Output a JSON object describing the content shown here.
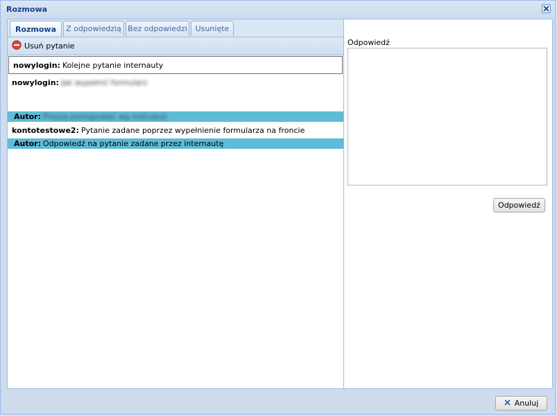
{
  "window": {
    "title": "Rozmowa"
  },
  "tabs": [
    {
      "label": "Rozmowa",
      "active": true
    },
    {
      "label": "Z odpowiedzią",
      "active": false
    },
    {
      "label": "Bez odpowiedzi",
      "active": false
    },
    {
      "label": "Usunięte",
      "active": false
    }
  ],
  "toolbar": {
    "delete_label": "Usuń pytanie"
  },
  "messages": [
    {
      "author": "nowylogin:",
      "text": "Kolejne pytanie internauty",
      "type": "question",
      "selected": true
    },
    {
      "author": "nowylogin:",
      "text": "Jak wypełnić formularz",
      "type": "question",
      "redacted": true
    },
    {
      "author": "Autor:",
      "text": "Proszę postępować wg instrukcji",
      "type": "answer",
      "redacted": true
    },
    {
      "author": "kontotestowe2:",
      "text": "Pytanie zadane poprzez wypełnienie formularza na froncie",
      "type": "question"
    },
    {
      "author": "Autor:",
      "text": "Odpowiedź na pytanie zadane przez internautę",
      "type": "answer"
    }
  ],
  "reply": {
    "label": "Odpowiedź",
    "value": "",
    "button_label": "Odpowiedź"
  },
  "footer": {
    "cancel_label": "Anuluj"
  },
  "colors": {
    "answer_row": "#5dbcd8",
    "title": "#15428b",
    "delete_icon": "#d9413a",
    "cancel_icon": "#2a5ba8"
  }
}
